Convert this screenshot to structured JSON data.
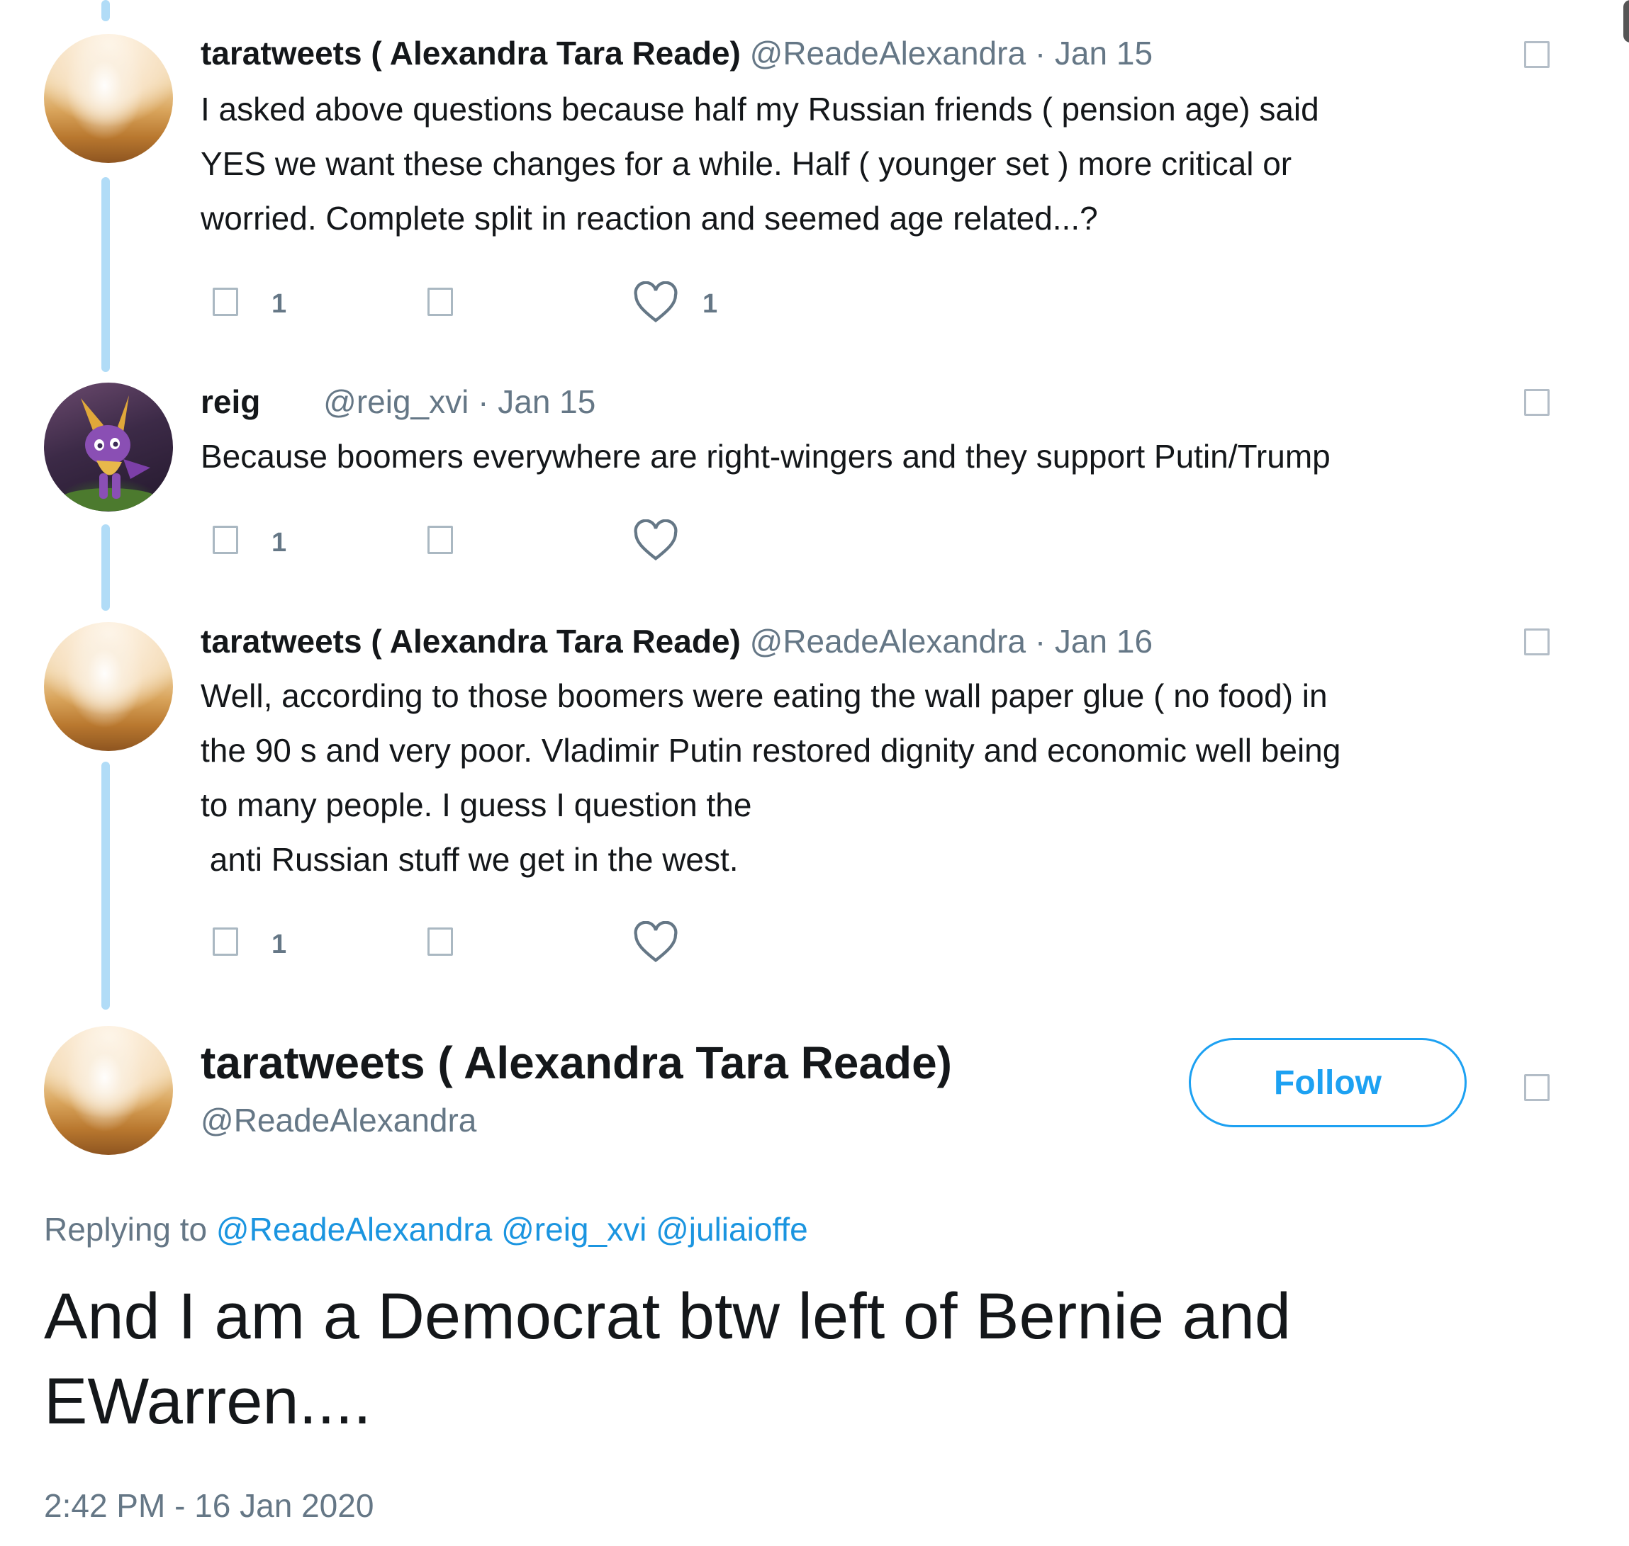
{
  "tweets": [
    {
      "name": "taratweets ( Alexandra Tara Reade)",
      "handle": "@ReadeAlexandra",
      "date": "· Jan 15",
      "lines": [
        "I asked above questions because half my Russian friends ( pension age) said",
        "YES we want these changes for a while. Half ( younger set ) more critical or",
        "worried. Complete split in reaction and seemed age related...?"
      ],
      "reply_count": "1",
      "like_count": "1"
    },
    {
      "name": "reig",
      "handle": "@reig_xvi",
      "date": "· Jan 15",
      "lines": [
        "Because boomers everywhere are right-wingers and they support Putin/Trump"
      ],
      "reply_count": "1",
      "like_count": ""
    },
    {
      "name": "taratweets ( Alexandra Tara Reade)",
      "handle": "@ReadeAlexandra",
      "date": "· Jan 16",
      "lines": [
        "Well, according to those boomers were eating the wall paper glue ( no food) in",
        "the 90 s and very poor. Vladimir Putin restored dignity and economic well being",
        "to many people. I guess I question the",
        " anti Russian stuff we get in the west."
      ],
      "reply_count": "1",
      "like_count": ""
    }
  ],
  "main_tweet": {
    "name": "taratweets ( Alexandra Tara Reade)",
    "handle": "@ReadeAlexandra",
    "follow_label": "Follow",
    "replying_prefix": "Replying to",
    "mentions": [
      "@ReadeAlexandra",
      "@reig_xvi",
      "@juliaioffe"
    ],
    "text_lines": [
      "And I am a Democrat btw left of Bernie and",
      "EWarren...."
    ],
    "timestamp": "2:42 PM - 16 Jan 2020"
  },
  "colors": {
    "link_blue": "#1da1f2",
    "thread_line": "#b1dcf7",
    "muted_text": "#657786"
  },
  "icons": [
    "reply-icon",
    "retweet-icon",
    "heart-icon",
    "caret-icon"
  ]
}
